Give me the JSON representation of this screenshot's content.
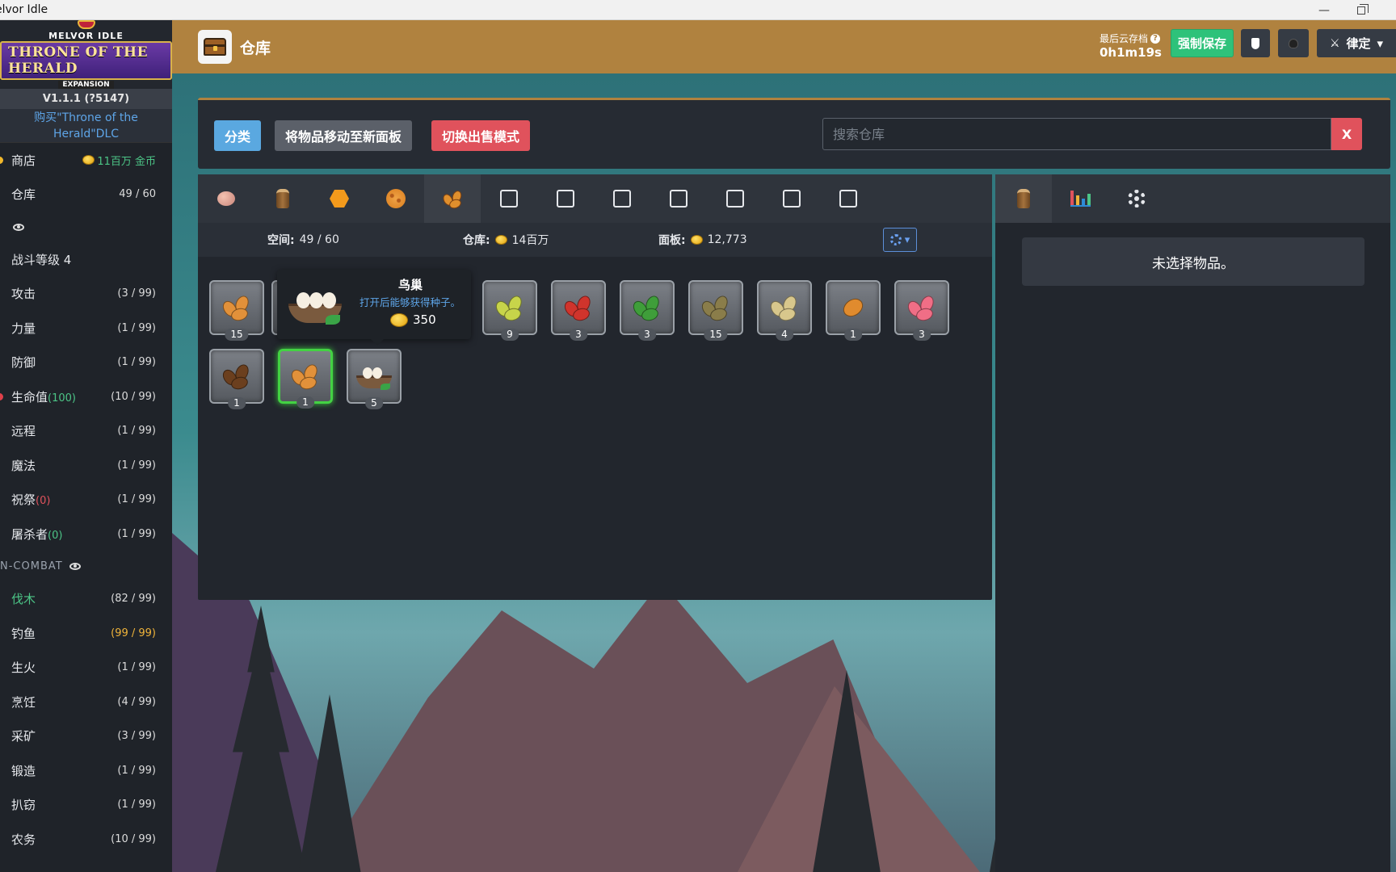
{
  "window": {
    "title": "elvor Idle",
    "minimize": "—",
    "maximize": ""
  },
  "sidebar": {
    "logo": {
      "line1": "MELVOR IDLE",
      "line2": "THRONE OF THE HERALD",
      "line3": "EXPANSION"
    },
    "version": "V1.1.1 (?5147)",
    "dlc_link": "购买\"Throne of the Herald\"DLC",
    "top_items": [
      {
        "name": "商店",
        "value": "11百万 金币",
        "bullet": "#f2b82b"
      },
      {
        "name": "仓库",
        "value": "49 / 60",
        "bullet": ""
      }
    ],
    "combat_items": [
      {
        "name": "战斗等级 4",
        "sub": "",
        "value": ""
      },
      {
        "name": "攻击",
        "sub": "",
        "value": "(3 / 99)"
      },
      {
        "name": "力量",
        "sub": "",
        "value": "(1 / 99)"
      },
      {
        "name": "防御",
        "sub": "",
        "value": "(1 / 99)"
      },
      {
        "name": "生命值",
        "sub": "(100)",
        "value": "(10 / 99)"
      },
      {
        "name": "远程",
        "sub": "",
        "value": "(1 / 99)"
      },
      {
        "name": "魔法",
        "sub": "",
        "value": "(1 / 99)"
      },
      {
        "name": "祝祭",
        "sub": "(0)",
        "value": "(1 / 99)"
      },
      {
        "name": "屠杀者",
        "sub": "(0)",
        "value": "(1 / 99)"
      }
    ],
    "noncombat_label": "N-COMBAT",
    "noncombat_items": [
      {
        "name": "伐木",
        "value": "(82 / 99)"
      },
      {
        "name": "钓鱼",
        "value": "(99 / 99)"
      },
      {
        "name": "生火",
        "value": "(1 / 99)"
      },
      {
        "name": "烹饪",
        "value": "(4 / 99)"
      },
      {
        "name": "采矿",
        "value": "(3 / 99)"
      },
      {
        "name": "锻造",
        "value": "(1 / 99)"
      },
      {
        "name": "扒窃",
        "value": "(1 / 99)"
      },
      {
        "name": "农务",
        "value": "(10 / 99)"
      }
    ]
  },
  "header": {
    "title": "仓库",
    "save_label": "最后云存档",
    "save_time": "0h1m19s",
    "force_save": "强制保存",
    "mode_label": "律定"
  },
  "toolbar": {
    "sort": "分类",
    "move": "将物品移动至新面板",
    "sell_mode": "切换出售模式",
    "search_placeholder": "搜索仓库",
    "clear": "X"
  },
  "bank": {
    "tabs": [
      "egg-icon",
      "log-icon",
      "hex-icon",
      "cookie-icon",
      "seeds-icon",
      "empty",
      "empty",
      "empty",
      "empty",
      "empty",
      "empty",
      "empty"
    ],
    "active_tab": 4,
    "space_label": "空间:",
    "space_value": "49 / 60",
    "bank_label": "仓库:",
    "bank_value": "14百万",
    "tab_label": "面板:",
    "tab_value": "12,773",
    "items": [
      {
        "qty": "15",
        "color": "#e2913a"
      },
      {
        "qty": "",
        "color": "#e2913a"
      },
      {
        "qty": "",
        "color": "#e2913a"
      },
      {
        "qty": "9",
        "color": "#c7d44a"
      },
      {
        "qty": "3",
        "color": "#d0342c"
      },
      {
        "qty": "3",
        "color": "#3f9e3a"
      },
      {
        "qty": "15",
        "color": "#8a7d4a"
      },
      {
        "qty": "4",
        "color": "#d8c78c"
      },
      {
        "qty": "1",
        "color": "#e08b2e"
      },
      {
        "qty": "3",
        "color": "#f06e86"
      },
      {
        "qty": "1",
        "color": "#6b3f1e"
      },
      {
        "qty": "1",
        "color": "#e2913a"
      },
      {
        "qty": "5",
        "color": "nest"
      }
    ]
  },
  "tooltip": {
    "name": "鸟巢",
    "description": "打开后能够获得种子。",
    "price": "350"
  },
  "side": {
    "tabs": [
      "log-icon",
      "stats-icon",
      "settings-icon"
    ],
    "no_selection": "未选择物品。"
  }
}
